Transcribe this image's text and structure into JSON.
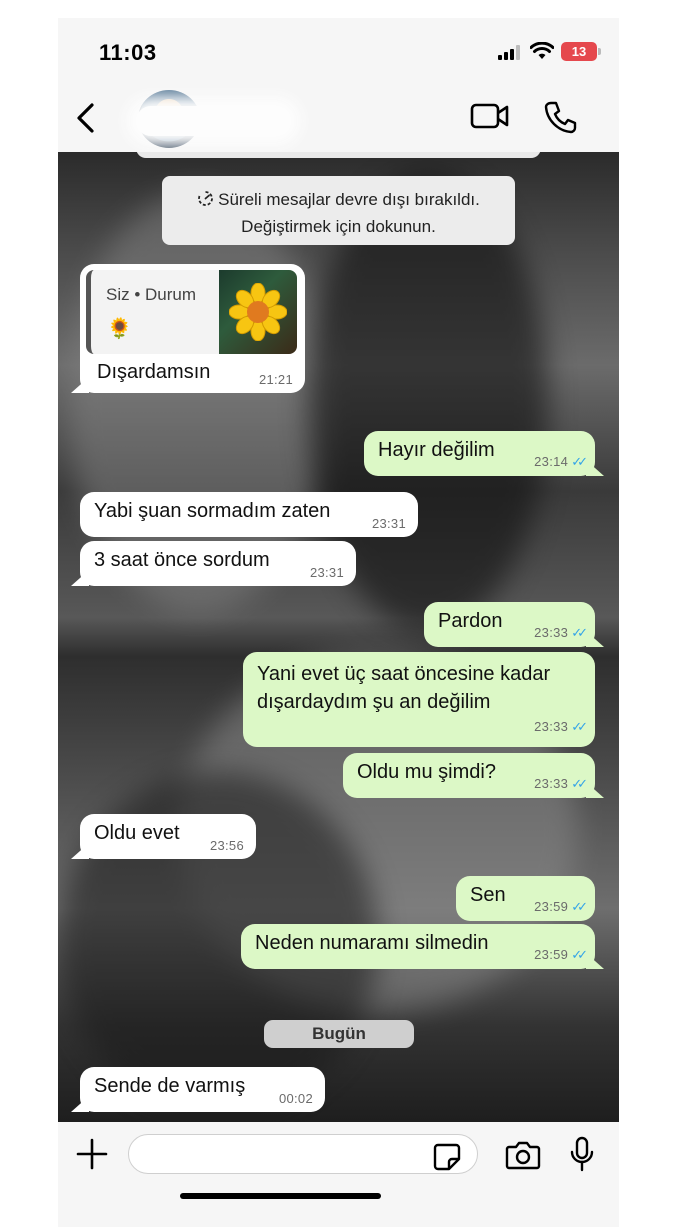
{
  "status_bar": {
    "time": "11:03",
    "battery": "13"
  },
  "header": {
    "contact_name": "",
    "icons": [
      "back-icon",
      "video-call-icon",
      "voice-call-icon"
    ]
  },
  "system_notice": {
    "line1": "Süreli mesajlar devre dışı bırakıldı.",
    "line2": "Değiştirmek için dokunun."
  },
  "reply": {
    "author": "Siz • Durum",
    "emoji": "🌻"
  },
  "messages": [
    {
      "dir": "in",
      "text": "Dışardamsın",
      "time": "21:21"
    },
    {
      "dir": "out",
      "text": "Hayır değilim",
      "time": "23:14"
    },
    {
      "dir": "in",
      "text": "Yabi şuan sormadım zaten",
      "time": "23:31"
    },
    {
      "dir": "in",
      "text": "3 saat önce sordum",
      "time": "23:31"
    },
    {
      "dir": "out",
      "text": "Pardon",
      "time": "23:33"
    },
    {
      "dir": "out",
      "line1": "Yani evet üç saat öncesine kadar",
      "line2": "dışardaydım şu an değilim",
      "time": "23:33"
    },
    {
      "dir": "out",
      "text": "Oldu mu şimdi?",
      "time": "23:33"
    },
    {
      "dir": "in",
      "text": "Oldu evet",
      "time": "23:56"
    },
    {
      "dir": "out",
      "text": "Sen",
      "time": "23:59"
    },
    {
      "dir": "out",
      "text": "Neden numaramı silmedin",
      "time": "23:59"
    },
    {
      "dir": "in",
      "text": "Sende de varmış",
      "time": "00:02"
    }
  ],
  "date_divider": "Bugün",
  "input": {
    "placeholder": "",
    "icons": [
      "add-icon",
      "sticker-icon",
      "camera-icon",
      "mic-icon"
    ]
  },
  "colors": {
    "incoming_bubble": "#ffffff",
    "outgoing_bubble": "#dcf8c6",
    "read_ticks": "#34a4e8",
    "battery_low": "#e5484d"
  }
}
